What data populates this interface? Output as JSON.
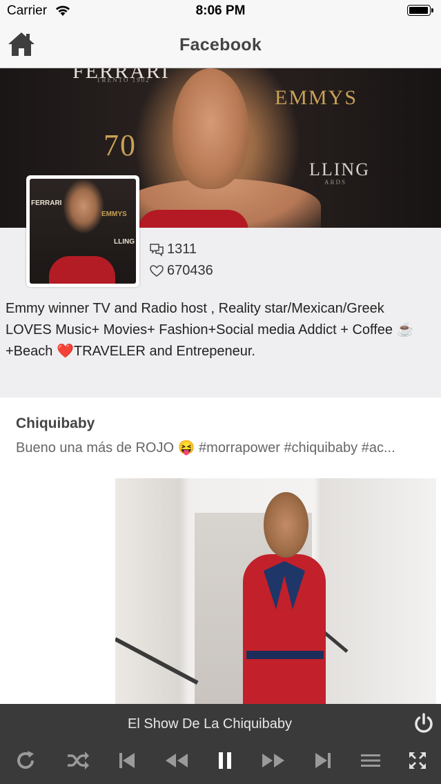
{
  "status": {
    "carrier": "Carrier",
    "time": "8:06 PM"
  },
  "nav": {
    "title": "Facebook"
  },
  "cover": {
    "logo_text": "FERRARI",
    "sub_text": "TRENTO 1902",
    "emmys": "EMMYS",
    "seventy": "70",
    "lling": "LLING",
    "ards": "ARDS"
  },
  "avatar": {
    "logo_text": "FERRARI",
    "emmys": "EMMYS",
    "lling": "LLING"
  },
  "profile": {
    "comments_count": "1311",
    "likes_count": "670436",
    "bio": "Emmy winner TV and Radio host , Reality star/Mexican/Greek LOVES Music+ Movies+ Fashion+Social media Addict + Coffee ☕ +Beach ❤️TRAVELER and Entrepeneur."
  },
  "post": {
    "author": "Chiquibaby",
    "text": "Bueno una más de ROJO 😝 #morrapower #chiquibaby #ac..."
  },
  "player": {
    "track_title": "El Show De La Chiquibaby",
    "controls": [
      "repeat-icon",
      "shuffle-icon",
      "skip-start-icon",
      "rewind-icon",
      "pause-icon",
      "fast-forward-icon",
      "skip-end-icon",
      "playlist-icon",
      "fullscreen-icon"
    ]
  },
  "colors": {
    "player_bg": "#3a3a3a",
    "control": "#9a9a9a",
    "accent_red": "#b31c25"
  }
}
